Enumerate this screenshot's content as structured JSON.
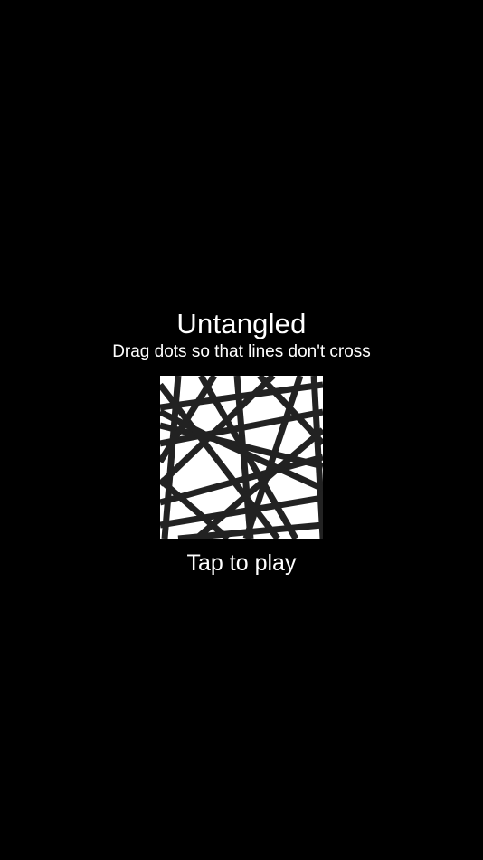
{
  "splash": {
    "title": "Untangled",
    "subtitle": "Drag dots so that lines don't cross",
    "play_label": "Tap to play"
  },
  "colors": {
    "background": "#000000",
    "text": "#ffffff",
    "art_background": "#ffffff",
    "art_lines": "#222222"
  },
  "icons": {
    "logo": "tangled-lines-logo"
  }
}
